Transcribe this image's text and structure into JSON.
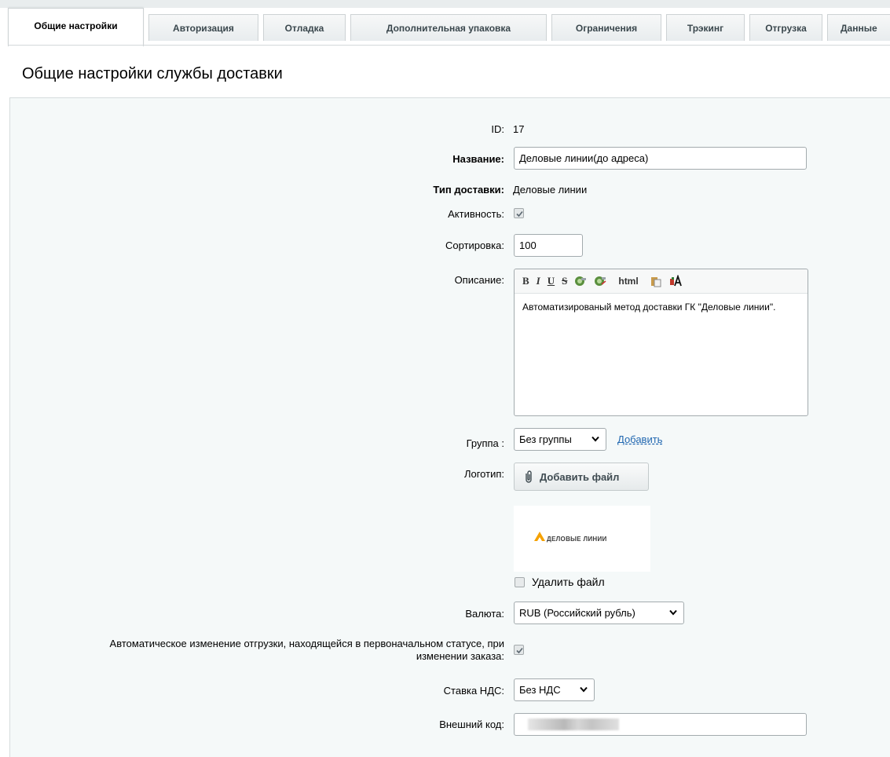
{
  "tabs": [
    {
      "label": "Общие настройки",
      "active": true
    },
    {
      "label": "Авторизация"
    },
    {
      "label": "Отладка"
    },
    {
      "label": "Дополнительная упаковка"
    },
    {
      "label": "Ограничения"
    },
    {
      "label": "Трэкинг"
    },
    {
      "label": "Отгрузка"
    },
    {
      "label": "Данные"
    }
  ],
  "page_title": "Общие настройки службы доставки",
  "form": {
    "id_label": "ID:",
    "id_value": "17",
    "name_label": "Название:",
    "name_value": "Деловые линии(до адреса)",
    "type_label": "Тип доставки:",
    "type_value": "Деловые линии",
    "active_label": "Активность:",
    "active_checked": true,
    "sort_label": "Сортировка:",
    "sort_value": "100",
    "description_label": "Описание:",
    "description_toolbar": [
      "B",
      "I",
      "U",
      "S",
      "link-icon",
      "unlink-icon",
      "html",
      "paste-icon",
      "font-icon"
    ],
    "description_html_label": "html",
    "description_value": "Автоматизированый метод доставки ГК \"Деловые линии\".",
    "group_label": "Группа :",
    "group_value": "Без группы",
    "group_add_link": "Добавить",
    "logo_label": "Логотип:",
    "add_file_label": "Добавить файл",
    "logo_text": "ДЕЛОВЫЕ ЛИНИИ",
    "delete_file_label": "Удалить файл",
    "delete_file_checked": false,
    "currency_label": "Валюта:",
    "currency_value": "RUB (Российский рубль)",
    "auto_change_label_line1": "Автоматическое изменение отгрузки, находящейся в первоначальном статусе, при",
    "auto_change_label_line2": "изменении заказа:",
    "auto_change_checked": true,
    "vat_label": "Ставка НДС:",
    "vat_value": "Без НДС",
    "external_code_label": "Внешний код:"
  },
  "colors": {
    "panel_bg": "#f5f9f9",
    "link": "#2067b0",
    "logo_accent": "#f5a100"
  }
}
